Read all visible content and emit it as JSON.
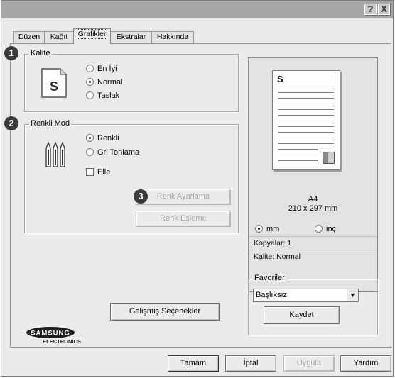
{
  "titlebar": {
    "help_label": "?",
    "close_label": "X"
  },
  "tabs": [
    {
      "label": "Düzen"
    },
    {
      "label": "Kağıt"
    },
    {
      "label": "Grafikler",
      "active": true
    },
    {
      "label": "Ekstralar"
    },
    {
      "label": "Hakkında"
    }
  ],
  "badges": [
    "1",
    "2",
    "3"
  ],
  "quality": {
    "title": "Kalite",
    "icon": "document-s-icon",
    "icon_letter": "S",
    "options": [
      {
        "label": "En İyi",
        "selected": false
      },
      {
        "label": "Normal",
        "selected": true
      },
      {
        "label": "Taslak",
        "selected": false
      }
    ]
  },
  "color_mode": {
    "title": "Renkli Mod",
    "icon": "color-pencils-icon",
    "options": [
      {
        "label": "Renkli",
        "selected": true
      },
      {
        "label": "Gri Tonlama",
        "selected": false
      }
    ],
    "manual_label": "Elle",
    "manual_checked": false,
    "adjust_button": "Renk Ayarlama",
    "matching_button": "Renk Eşleme"
  },
  "advanced_button": "Gelişmiş Seçenekler",
  "preview": {
    "page_letter": "S",
    "paper_name": "A4",
    "paper_size": "210 x 297 mm",
    "units": [
      {
        "label": "mm",
        "selected": true
      },
      {
        "label": "inç",
        "selected": false
      }
    ],
    "copies": "Kopyalar: 1",
    "quality": "Kalite: Normal"
  },
  "favorites": {
    "title": "Favoriler",
    "selected": "Başlıksız",
    "save_button": "Kaydet"
  },
  "logo": {
    "brand": "SAMSUNG",
    "sub": "ELECTRONICS"
  },
  "footer": {
    "ok": "Tamam",
    "cancel": "İptal",
    "apply": "Uygula",
    "help": "Yardım"
  }
}
